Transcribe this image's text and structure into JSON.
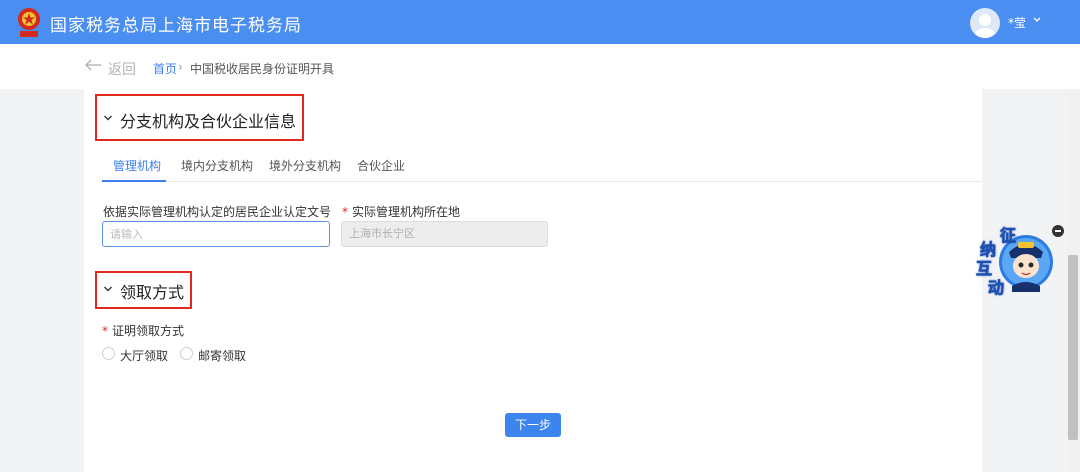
{
  "header": {
    "title": "国家税务总局上海市电子税务局",
    "user_name": "*莹",
    "emblem_icon": "national-emblem-icon",
    "avatar_icon": "user-avatar-icon"
  },
  "breadcrumb": {
    "back_label": "返回",
    "home": "首页",
    "separator": "›",
    "current": "中国税收居民身份证明开具"
  },
  "section_branch": {
    "title": "分支机构及合伙企业信息",
    "tabs": [
      {
        "label": "管理机构",
        "active": true
      },
      {
        "label": "境内分支机构",
        "active": false
      },
      {
        "label": "境外分支机构",
        "active": false
      },
      {
        "label": "合伙企业",
        "active": false
      }
    ],
    "field_doc_label": "依据实际管理机构认定的居民企业认定文号",
    "field_doc_placeholder": "请输入",
    "field_location_required": "*",
    "field_location_label": "实际管理机构所在地",
    "field_location_value": "上海市长宁区"
  },
  "section_receive": {
    "title": "领取方式",
    "method_required": "*",
    "method_label": "证明领取方式",
    "options": [
      {
        "label": "大厅领取",
        "selected": false
      },
      {
        "label": "邮寄领取",
        "selected": false
      }
    ]
  },
  "actions": {
    "next_label": "下一步"
  },
  "mascot": {
    "chars": [
      "征",
      "纳",
      "互",
      "动"
    ]
  },
  "colors": {
    "header_blue": "#4b8ef1",
    "accent_blue": "#3d7ff0",
    "highlight_red": "#e12a1e"
  }
}
